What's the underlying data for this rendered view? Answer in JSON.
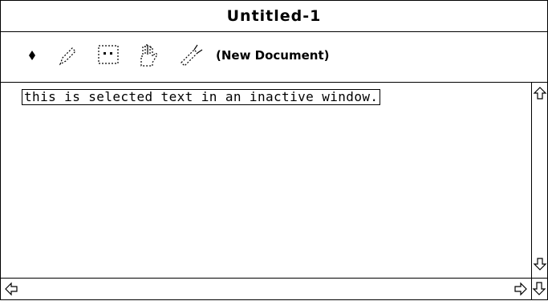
{
  "window": {
    "title": "Untitled-1"
  },
  "toolbar": {
    "tools": [
      {
        "icon": "diamond-icon",
        "label": ""
      },
      {
        "icon": "pencil-icon",
        "label": ""
      },
      {
        "icon": "dotted-rectangle-icon",
        "label": ""
      },
      {
        "icon": "grabber-hand-icon",
        "label": ""
      },
      {
        "icon": "spray-can-icon",
        "label": ""
      }
    ],
    "document_label": "(New Document)"
  },
  "content": {
    "selected_text": "this is selected text in an inactive window."
  },
  "colors": {
    "foreground": "#000000",
    "background": "#ffffff"
  }
}
